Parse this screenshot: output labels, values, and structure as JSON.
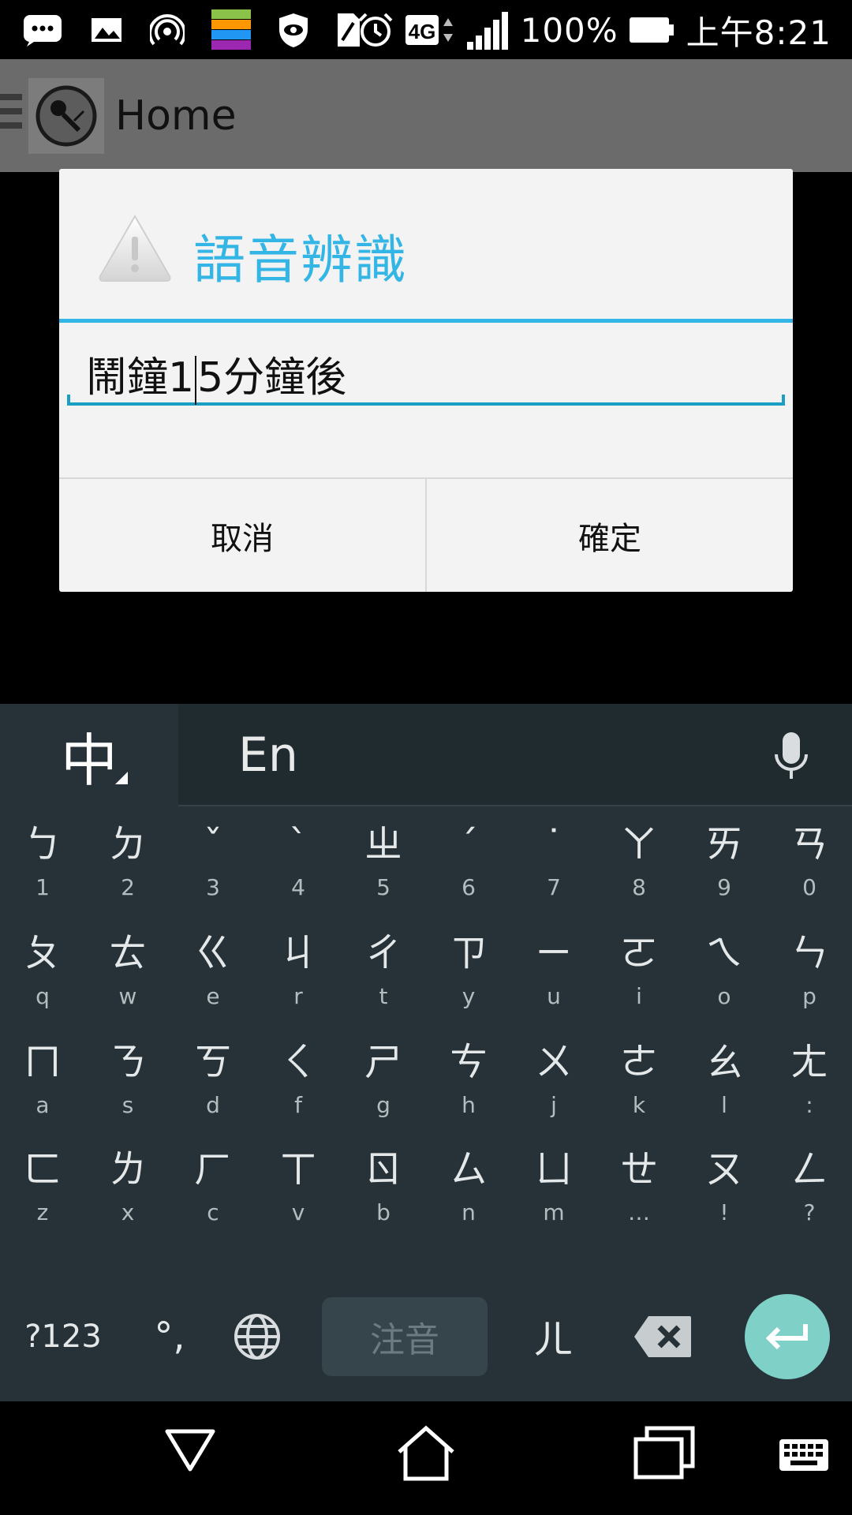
{
  "status_bar": {
    "battery_percent": "100%",
    "time": "上午8:21",
    "network": "4G",
    "icons": [
      "chat-bubble-icon",
      "picture-icon",
      "hotspot-icon",
      "app-stack-icon",
      "shield-eye-icon",
      "sim-icon",
      "alarm-icon",
      "network-4g-icon",
      "signal-icon",
      "battery-icon"
    ]
  },
  "app_bar": {
    "title": "Home",
    "logo_icon": "microphone-logo-icon"
  },
  "dialog": {
    "title": "語音辨識",
    "icon": "warning-icon",
    "input_before_caret": "鬧鐘1",
    "input_after_caret": "5分鐘後",
    "cancel_label": "取消",
    "ok_label": "確定",
    "accent_color": "#33b5e5"
  },
  "keyboard": {
    "mode_chinese": "中",
    "mode_english": "En",
    "rows": [
      [
        {
          "main": "ㄅ",
          "sub": "1"
        },
        {
          "main": "ㄉ",
          "sub": "2"
        },
        {
          "main": "ˇ",
          "sub": "3"
        },
        {
          "main": "ˋ",
          "sub": "4"
        },
        {
          "main": "ㄓ",
          "sub": "5"
        },
        {
          "main": "ˊ",
          "sub": "6"
        },
        {
          "main": "˙",
          "sub": "7"
        },
        {
          "main": "ㄚ",
          "sub": "8"
        },
        {
          "main": "ㄞ",
          "sub": "9"
        },
        {
          "main": "ㄢ",
          "sub": "0"
        }
      ],
      [
        {
          "main": "ㄆ",
          "sub": "q"
        },
        {
          "main": "ㄊ",
          "sub": "w"
        },
        {
          "main": "ㄍ",
          "sub": "e"
        },
        {
          "main": "ㄐ",
          "sub": "r"
        },
        {
          "main": "ㄔ",
          "sub": "t"
        },
        {
          "main": "ㄗ",
          "sub": "y"
        },
        {
          "main": "ㄧ",
          "sub": "u"
        },
        {
          "main": "ㄛ",
          "sub": "i"
        },
        {
          "main": "ㄟ",
          "sub": "o"
        },
        {
          "main": "ㄣ",
          "sub": "p"
        }
      ],
      [
        {
          "main": "ㄇ",
          "sub": "a"
        },
        {
          "main": "ㄋ",
          "sub": "s"
        },
        {
          "main": "ㄎ",
          "sub": "d"
        },
        {
          "main": "ㄑ",
          "sub": "f"
        },
        {
          "main": "ㄕ",
          "sub": "g"
        },
        {
          "main": "ㄘ",
          "sub": "h"
        },
        {
          "main": "ㄨ",
          "sub": "j"
        },
        {
          "main": "ㄜ",
          "sub": "k"
        },
        {
          "main": "ㄠ",
          "sub": "l"
        },
        {
          "main": "ㄤ",
          "sub": ":"
        }
      ],
      [
        {
          "main": "ㄈ",
          "sub": "z"
        },
        {
          "main": "ㄌ",
          "sub": "x"
        },
        {
          "main": "ㄏ",
          "sub": "c"
        },
        {
          "main": "ㄒ",
          "sub": "v"
        },
        {
          "main": "ㄖ",
          "sub": "b"
        },
        {
          "main": "ㄙ",
          "sub": "n"
        },
        {
          "main": "ㄩ",
          "sub": "m"
        },
        {
          "main": "ㄝ",
          "sub": "…"
        },
        {
          "main": "ㄡ",
          "sub": "!"
        },
        {
          "main": "ㄥ",
          "sub": "?"
        }
      ]
    ],
    "symbols_label": "?123",
    "punct_label": "°,",
    "space_label": "注音",
    "er_label": "ㄦ",
    "background_color": "#263238",
    "enter_color": "#7fd0c7"
  },
  "nav_bar": {
    "icons": [
      "back-icon",
      "home-icon",
      "recents-icon",
      "keyboard-icon"
    ]
  }
}
